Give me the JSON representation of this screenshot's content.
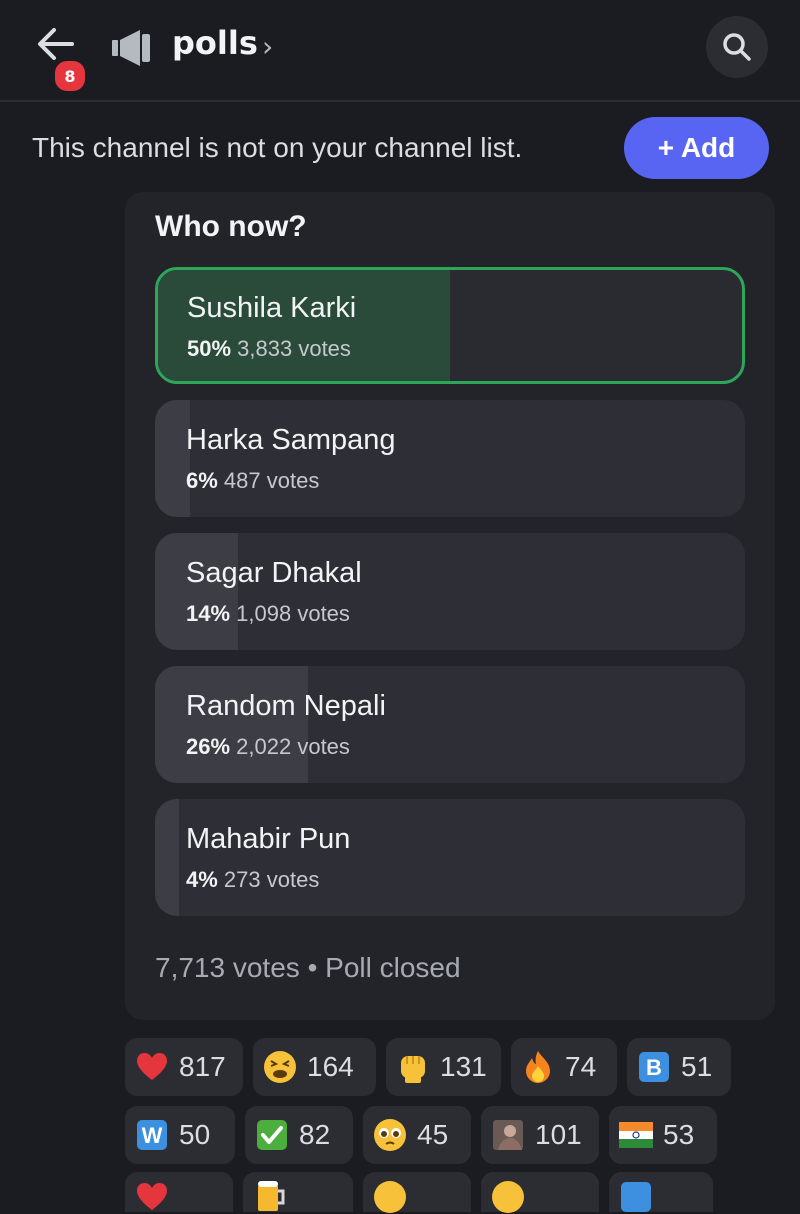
{
  "header": {
    "back_badge": "8",
    "channel_name": "polls",
    "chevron": "›"
  },
  "notice": {
    "text": "This channel is not on your channel list.",
    "add_label": "+ Add"
  },
  "poll": {
    "question": "Who now?",
    "options": [
      {
        "label": "Sushila Karki",
        "percent": "50%",
        "votes": "3,833 votes",
        "fill_fraction": 0.5,
        "winner": true
      },
      {
        "label": "Harka Sampang",
        "percent": "6%",
        "votes": "487 votes",
        "fill_fraction": 0.06,
        "winner": false
      },
      {
        "label": "Sagar Dhakal",
        "percent": "14%",
        "votes": "1,098 votes",
        "fill_fraction": 0.14,
        "winner": false
      },
      {
        "label": "Random Nepali",
        "percent": "26%",
        "votes": "2,022 votes",
        "fill_fraction": 0.26,
        "winner": false
      },
      {
        "label": "Mahabir Pun",
        "percent": "4%",
        "votes": "273 votes",
        "fill_fraction": 0.04,
        "winner": false
      }
    ],
    "footer_total": "7,713 votes",
    "footer_sep": "•",
    "footer_status": "Poll closed"
  },
  "reactions": [
    {
      "icon": "heart-icon",
      "count": "817"
    },
    {
      "icon": "tired-face-icon",
      "count": "164"
    },
    {
      "icon": "raised-fist-icon",
      "count": "131"
    },
    {
      "icon": "fire-icon",
      "count": "74"
    },
    {
      "icon": "letter-b-icon",
      "count": "51"
    },
    {
      "icon": "letter-w-icon",
      "count": "50"
    },
    {
      "icon": "check-mark-icon",
      "count": "82"
    },
    {
      "icon": "pleading-face-icon",
      "count": "45"
    },
    {
      "icon": "custom-photo-icon",
      "count": "101"
    },
    {
      "icon": "india-flag-icon",
      "count": "53"
    }
  ],
  "colors": {
    "accent": "#5865f2",
    "winner_border": "#2ea65a",
    "badge": "#e5353d"
  }
}
